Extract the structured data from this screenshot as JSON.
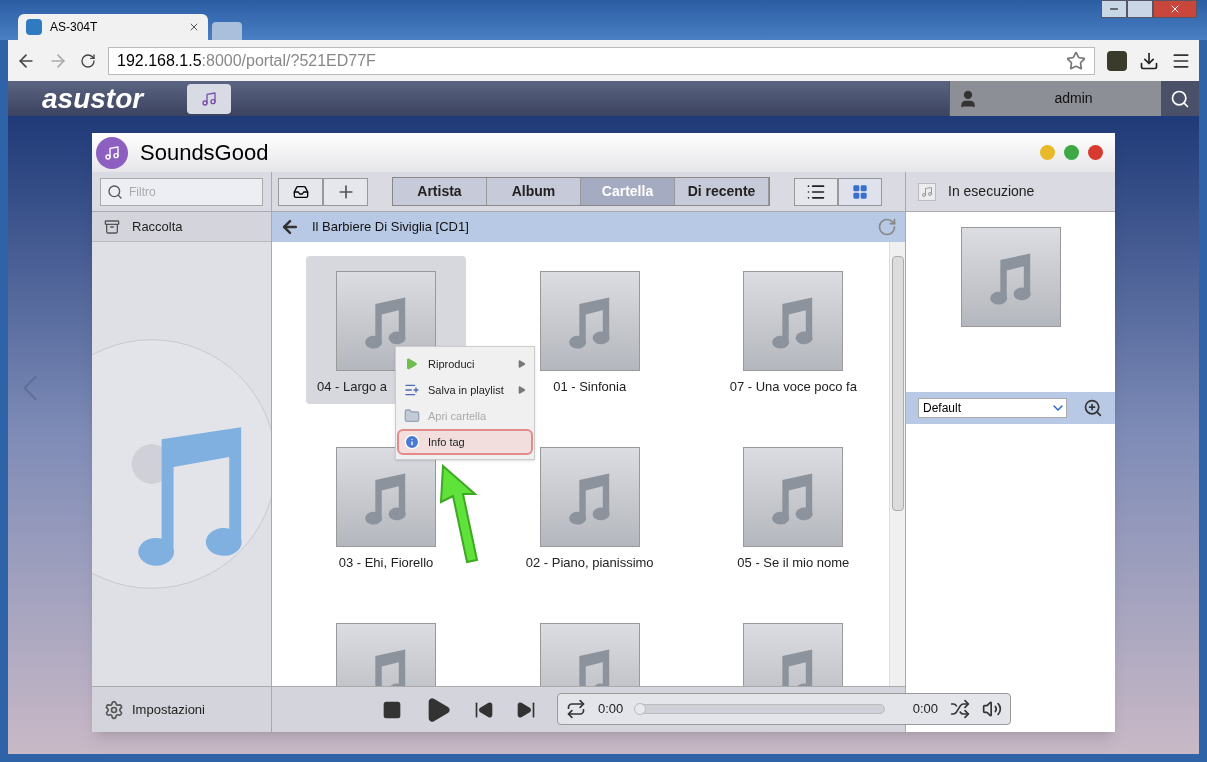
{
  "browser": {
    "tab_title": "AS-304T",
    "address_host": "192.168.1.5",
    "address_path": ":8000/portal/?521ED77F"
  },
  "nas_bar": {
    "brand": "asustor",
    "user": "admin"
  },
  "app": {
    "title": "SoundsGood",
    "search": {
      "placeholder": "Filtro"
    },
    "sidebar": {
      "items": [
        {
          "label": "Raccolta",
          "selected": false
        }
      ],
      "settings": "Impostazioni"
    },
    "view_tabs": [
      {
        "label": "Artista",
        "selected": false
      },
      {
        "label": "Album",
        "selected": false
      },
      {
        "label": "Cartella",
        "selected": true
      },
      {
        "label": "Di recente",
        "selected": false
      }
    ],
    "view_modes": [
      {
        "kind": "list",
        "selected": false
      },
      {
        "kind": "grid",
        "selected": true
      }
    ],
    "breadcrumb": "Il Barbiere Di Siviglia [CD1]",
    "tracks": [
      {
        "title": "04 - Largo a",
        "selected": true
      },
      {
        "title": "01 - Sinfonia",
        "selected": false
      },
      {
        "title": "07 - Una voce poco fa",
        "selected": false
      },
      {
        "title": "03 - Ehi, Fiorello",
        "selected": false
      },
      {
        "title": "02 - Piano, pianissimo",
        "selected": false
      },
      {
        "title": "05 - Se il mio nome",
        "selected": false
      },
      {
        "selected": false
      },
      {
        "selected": false
      },
      {
        "selected": false
      }
    ],
    "context_menu": [
      {
        "kind": "play",
        "label": "Riproduci",
        "submenu": true,
        "disabled": false,
        "highlighted": false
      },
      {
        "kind": "playlist",
        "label": "Salva in playlist",
        "submenu": true,
        "disabled": false,
        "highlighted": false
      },
      {
        "kind": "folder",
        "label": "Apri cartella",
        "submenu": false,
        "disabled": true,
        "highlighted": false
      },
      {
        "kind": "info",
        "label": "Info tag",
        "submenu": false,
        "disabled": false,
        "highlighted": true
      }
    ],
    "now_playing": {
      "title": "In esecuzione",
      "playlist": "Default"
    },
    "player": {
      "elapsed": "0:00",
      "total": "0:00",
      "level": 0
    }
  }
}
